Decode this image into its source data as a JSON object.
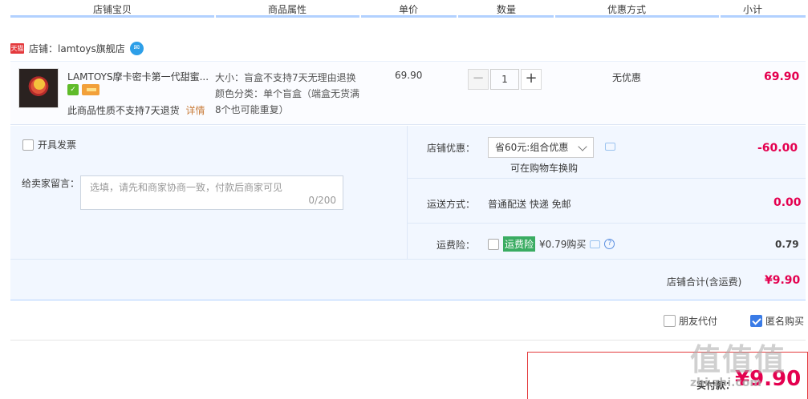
{
  "columns": [
    "店铺宝贝",
    "商品属性",
    "单价",
    "数量",
    "优惠方式",
    "小计"
  ],
  "shop": {
    "tmall_badge": "天猫",
    "label": "店铺：lamtoys旗舰店"
  },
  "item": {
    "title": "LAMTOYS摩卡密卡第一代甜蜜...",
    "notice": "此商品性质不支持7天退货",
    "detail_link": "详情",
    "attr_size": "大小：盲盒不支持7天无理由退换",
    "attr_color_1": "颜色分类：单个盲盒（端盒无货满",
    "attr_color_2": "8个也可能重复）",
    "unit_price": "69.90",
    "quantity": "1",
    "qty_minus": "−",
    "qty_plus": "+",
    "discount_method": "无优惠",
    "subtotal": "69.90"
  },
  "invoice": {
    "label": "开具发票"
  },
  "message": {
    "label": "给卖家留言：",
    "placeholder": "选填，请先和商家协商一致，付款后商家可见",
    "counter": "0/200"
  },
  "shop_discount": {
    "label": "店铺优惠：",
    "selected": "省60元:组合优惠",
    "hint": "可在购物车换购",
    "amount": "-60.00"
  },
  "shipping": {
    "label": "运送方式：",
    "method": "普通配送 快递 免邮",
    "amount": "0.00"
  },
  "insurance": {
    "label": "运费险：",
    "tag": "运费险",
    "price_text": "¥0.79购买",
    "help": "?",
    "amount": "0.79"
  },
  "shop_total": {
    "label": "店铺合计(含运费)",
    "amount": "¥9.90"
  },
  "options": {
    "friend_pay": "朋友代付",
    "anonymous": "匿名购买"
  },
  "payment": {
    "label": "实付款：",
    "amount": "¥9.90"
  },
  "watermark": {
    "logo": "值值值",
    "site": "zhi.zhi.com"
  },
  "colors": {
    "accent_red": "#e4004f",
    "header_line": "#b2d1ff",
    "panel_bg": "#f2f7ff",
    "checkbox_blue": "#3a7be6"
  }
}
